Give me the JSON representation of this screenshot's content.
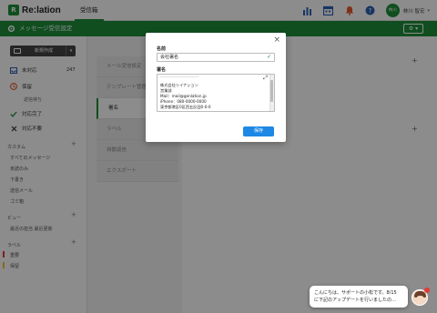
{
  "app": {
    "logo_text": "Re:lation",
    "logo_mark": "R"
  },
  "nav": {
    "tab_label": "受信箱"
  },
  "user": {
    "avatar_text": "林川",
    "name": "林川 智宏"
  },
  "header": {
    "title": "メッセージ受信設定",
    "gear_label": "⚙ ▾"
  },
  "sidebar": {
    "new_button_label": "新規作成",
    "items": [
      {
        "label": "未対応",
        "count": "247",
        "icon": "inbox-icon"
      },
      {
        "label": "保留",
        "icon": "clock-icon"
      },
      {
        "label": "対応完了",
        "icon": "check-icon"
      },
      {
        "label": "対応不要",
        "icon": "cross-icon"
      }
    ],
    "sub_item": "返信待ち",
    "section_custom": "カスタム",
    "custom_links": [
      "すべてのメッセージ",
      "未読のみ",
      "下書き",
      "送信メール",
      "ゴミ箱"
    ],
    "section_view": "ビュー",
    "view_links": [
      "最近の担当 最近更新"
    ],
    "section_labels": "ラベル",
    "labels": [
      {
        "name": "重要",
        "color": "#e53935"
      },
      {
        "name": "保留",
        "color": "#fbc02d"
      }
    ]
  },
  "settings_menu": {
    "items": [
      "メール受信設定",
      "テンプレート管理",
      "署名",
      "ラベル",
      "自動返信",
      "エクスポート"
    ],
    "active_index": 2
  },
  "modal": {
    "name_label": "名前",
    "name_value": "会社署名",
    "signature_label": "署名",
    "signature_separator": "----------------------------",
    "signature_lines": [
      "株式会社リイナション",
      "営業部",
      "Mail：mail@genlation.jp",
      "iPhone：080-0000-0000",
      "東京都港区0区西五反田0-0-0"
    ],
    "save_label": "保存",
    "close_label": "×"
  },
  "chat": {
    "line1": "こんにちは、サポートの小松です。8/15",
    "line2": "に下記のアップデートを行いましたの…"
  },
  "colors": {
    "brand_green": "#1e8f3a",
    "save_blue": "#1e88e5"
  }
}
